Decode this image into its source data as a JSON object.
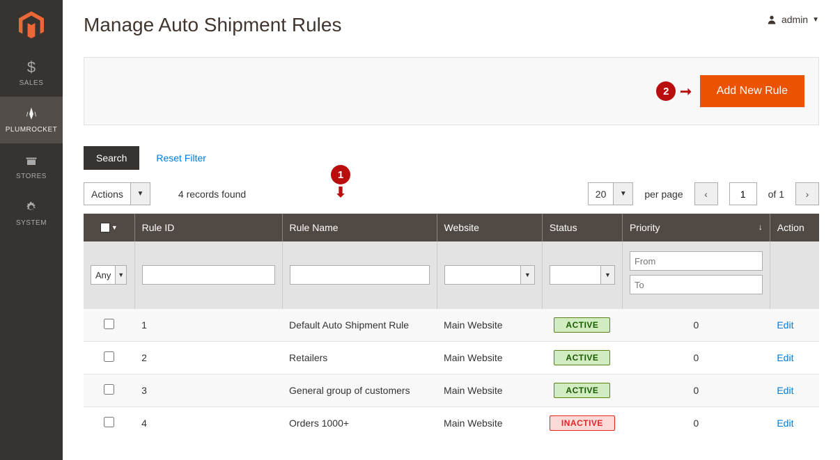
{
  "sidebar": {
    "items": [
      {
        "label": "SALES"
      },
      {
        "label": "PLUMROCKET"
      },
      {
        "label": "STORES"
      },
      {
        "label": "SYSTEM"
      }
    ]
  },
  "header": {
    "title": "Manage Auto Shipment Rules",
    "username": "admin"
  },
  "actions": {
    "add_rule": "Add New Rule"
  },
  "filter": {
    "search": "Search",
    "reset": "Reset Filter"
  },
  "toolbar": {
    "actions_label": "Actions",
    "records_found": "4 records found",
    "page_size": "20",
    "per_page": "per page",
    "current_page": "1",
    "page_total": "of 1"
  },
  "columns": {
    "rule_id": "Rule ID",
    "rule_name": "Rule Name",
    "website": "Website",
    "status": "Status",
    "priority": "Priority",
    "action": "Action"
  },
  "filters": {
    "any": "Any",
    "from": "From",
    "to": "To"
  },
  "rows": [
    {
      "id": "1",
      "name": "Default Auto Shipment Rule",
      "website": "Main Website",
      "status": "ACTIVE",
      "priority": "0",
      "action": "Edit"
    },
    {
      "id": "2",
      "name": "Retailers",
      "website": "Main Website",
      "status": "ACTIVE",
      "priority": "0",
      "action": "Edit"
    },
    {
      "id": "3",
      "name": "General group of customers",
      "website": "Main Website",
      "status": "ACTIVE",
      "priority": "0",
      "action": "Edit"
    },
    {
      "id": "4",
      "name": "Orders 1000+",
      "website": "Main Website",
      "status": "INACTIVE",
      "priority": "0",
      "action": "Edit"
    }
  ],
  "annotations": {
    "a1": "1",
    "a2": "2"
  },
  "status_class": {
    "ACTIVE": "status-active",
    "INACTIVE": "status-inactive"
  }
}
